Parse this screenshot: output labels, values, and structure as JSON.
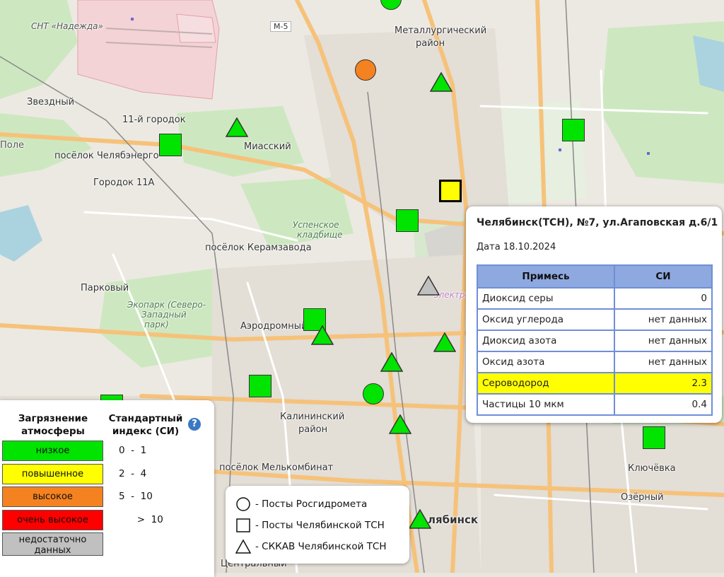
{
  "map": {
    "place_labels": [
      {
        "text": "СНТ «Надежда»"
      },
      {
        "text": "М-5"
      },
      {
        "text": "Металлургический"
      },
      {
        "text": "район"
      },
      {
        "text": "Звездный"
      },
      {
        "text": "11-й городок"
      },
      {
        "text": "Поле"
      },
      {
        "text": "посёлок Челябэнерго"
      },
      {
        "text": "Миасский"
      },
      {
        "text": "Городок 11А"
      },
      {
        "text": "Успенское"
      },
      {
        "text": "кладбище"
      },
      {
        "text": "посёлок Керамзавода"
      },
      {
        "text": "Парковый"
      },
      {
        "text": "Экопарк (Северо-"
      },
      {
        "text": "Западный"
      },
      {
        "text": "парк)"
      },
      {
        "text": "Аэродромный"
      },
      {
        "text": "Калининский"
      },
      {
        "text": "район"
      },
      {
        "text": "посёлок Мелькомбинат"
      },
      {
        "text": "Ключёвка"
      },
      {
        "text": "Озёрный"
      },
      {
        "text": "лябинск"
      },
      {
        "text": "Центральный"
      },
      {
        "text": "электро"
      }
    ],
    "markers": [
      {
        "shape": "circle",
        "level": "high",
        "color": "#f58220"
      },
      {
        "shape": "circle",
        "level": "low",
        "color": "#00e400"
      },
      {
        "shape": "circle",
        "level": "low",
        "color": "#00e400"
      },
      {
        "shape": "square",
        "level": "low",
        "color": "#00e400"
      },
      {
        "shape": "square",
        "level": "low",
        "color": "#00e400"
      },
      {
        "shape": "square",
        "level": "elevated",
        "color": "#ffff00"
      },
      {
        "shape": "square",
        "level": "low",
        "color": "#00e400"
      },
      {
        "shape": "square",
        "level": "low",
        "color": "#00e400"
      },
      {
        "shape": "square",
        "level": "low",
        "color": "#00e400"
      },
      {
        "shape": "square",
        "level": "low",
        "color": "#00e400"
      },
      {
        "shape": "square",
        "level": "low",
        "color": "#00e400"
      },
      {
        "shape": "triangle",
        "level": "low",
        "color": "#00e400"
      },
      {
        "shape": "triangle",
        "level": "low",
        "color": "#00e400"
      },
      {
        "shape": "triangle",
        "level": "no-data",
        "color": "#c0c0c0"
      },
      {
        "shape": "triangle",
        "level": "low",
        "color": "#00e400"
      },
      {
        "shape": "triangle",
        "level": "low",
        "color": "#00e400"
      },
      {
        "shape": "triangle",
        "level": "low",
        "color": "#00e400"
      },
      {
        "shape": "triangle",
        "level": "low",
        "color": "#00e400"
      },
      {
        "shape": "triangle",
        "level": "low",
        "color": "#00e400"
      }
    ]
  },
  "popup": {
    "title": "Челябинск(ТСН), №7, ул.Агаповская д.6/1",
    "date": "Дата 18.10.2024",
    "columns": [
      "Примесь",
      "СИ"
    ],
    "rows": [
      {
        "name": "Диоксид серы",
        "value": "0",
        "highlight": false
      },
      {
        "name": "Оксид углерода",
        "value": "нет данных",
        "highlight": false
      },
      {
        "name": "Диоксид азота",
        "value": "нет данных",
        "highlight": false
      },
      {
        "name": "Оксид азота",
        "value": "нет данных",
        "highlight": false
      },
      {
        "name": "Сероводород",
        "value": "2.3",
        "highlight": true
      },
      {
        "name": "Частицы 10 мкм",
        "value": "0.4",
        "highlight": false
      }
    ],
    "highlight_color": "#ffff00"
  },
  "legend": {
    "col1_title": "Загрязнение атмосферы",
    "col2_title": "Стандартный индекс (СИ)",
    "help_icon": "question-icon",
    "levels": [
      {
        "label": "низкое",
        "color": "#00e400",
        "range": "0  -  1",
        "text_color": "#111"
      },
      {
        "label": "повышенное",
        "color": "#ffff00",
        "range": "2  -  4",
        "text_color": "#111"
      },
      {
        "label": "высокое",
        "color": "#f58220",
        "range": "5  -  10",
        "text_color": "#111"
      },
      {
        "label": "очень высокое",
        "color": "#ff0000",
        "range": "      >  10",
        "text_color": "#111"
      },
      {
        "label": "недостаточно данных",
        "color": "#c0c0c0",
        "range": "",
        "text_color": "#111"
      }
    ]
  },
  "symbol_legend": {
    "items": [
      {
        "icon": "circle-icon",
        "label": "- Посты Росгидромета"
      },
      {
        "icon": "square-icon",
        "label": "- Посты Челябинской ТСН"
      },
      {
        "icon": "triangle-icon",
        "label": "- СККАВ Челябинской ТСН"
      }
    ]
  }
}
